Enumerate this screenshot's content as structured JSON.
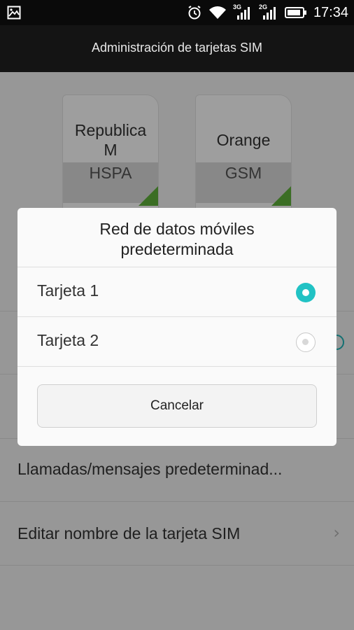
{
  "status_bar": {
    "time": "17:34",
    "network_1": "3G",
    "network_2": "2G",
    "icons": [
      "gallery-icon",
      "alarm-icon",
      "wifi-icon",
      "signal-icon",
      "battery-icon"
    ]
  },
  "header": {
    "title": "Administración de tarjetas SIM"
  },
  "sim_cards": [
    {
      "name_line1": "Republica",
      "name_line2": "M",
      "network": "HSPA"
    },
    {
      "name": "Orange",
      "network": "GSM"
    }
  ],
  "settings": {
    "default_calls_label": "Llamadas/mensajes predeterminad...",
    "edit_sim_name_label": "Editar nombre de la tarjeta SIM"
  },
  "dialog": {
    "title_line1": "Red de datos móviles",
    "title_line2": "predeterminada",
    "options": [
      {
        "label": "Tarjeta 1",
        "selected": true
      },
      {
        "label": "Tarjeta 2",
        "selected": false
      }
    ],
    "cancel_label": "Cancelar"
  },
  "colors": {
    "accent": "#21c2c4",
    "sim_active": "#5fb23a",
    "header_bg": "#141414"
  }
}
